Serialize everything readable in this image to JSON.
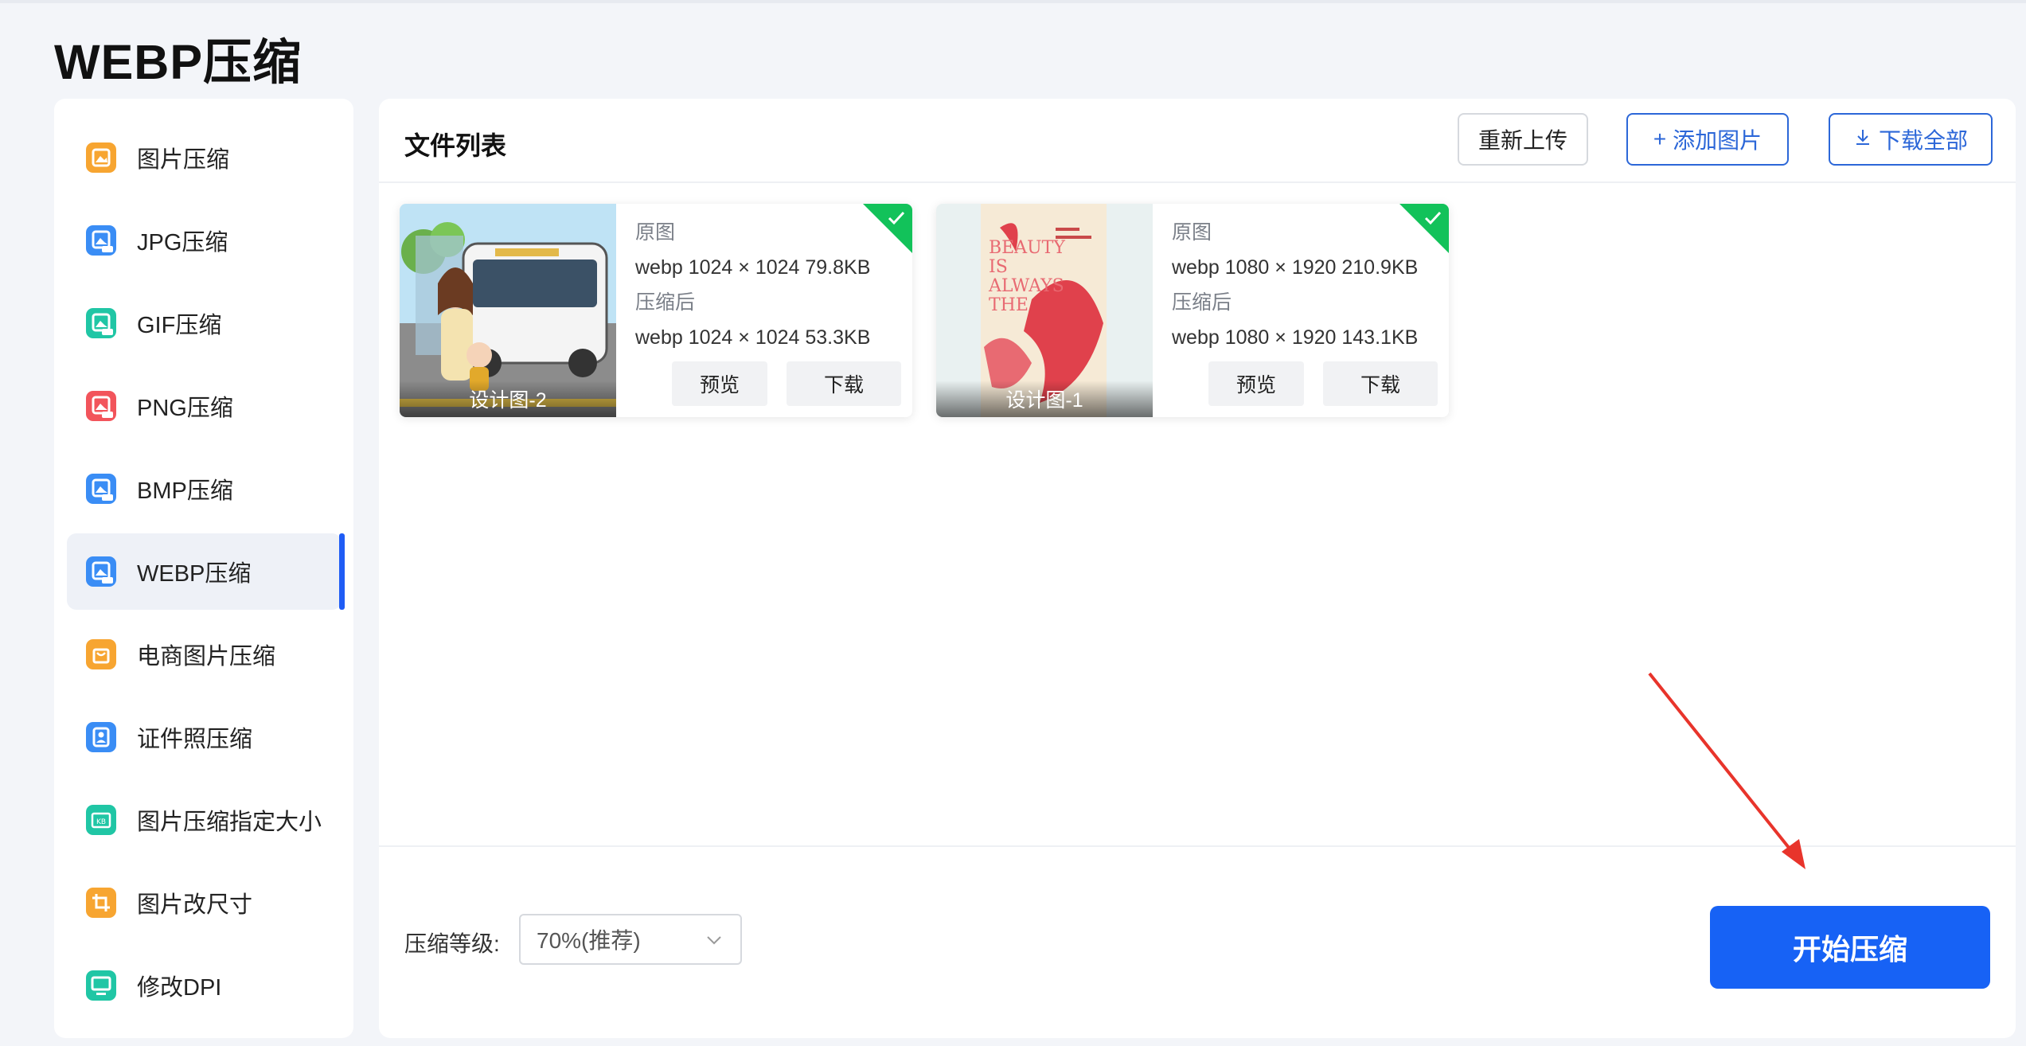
{
  "page": {
    "title": "WEBP压缩"
  },
  "sidebar": {
    "active_index": 5,
    "items": [
      {
        "label": "图片压缩",
        "icon": "image-compress-icon",
        "color": "#f7a531"
      },
      {
        "label": "JPG压缩",
        "icon": "jpg-icon",
        "color": "#3a8df5"
      },
      {
        "label": "GIF压缩",
        "icon": "gif-icon",
        "color": "#20c6a5"
      },
      {
        "label": "PNG压缩",
        "icon": "png-icon",
        "color": "#f2545b"
      },
      {
        "label": "BMP压缩",
        "icon": "bmp-icon",
        "color": "#3a8df5"
      },
      {
        "label": "WEBP压缩",
        "icon": "webp-icon",
        "color": "#3a8df5"
      },
      {
        "label": "电商图片压缩",
        "icon": "shopping-bag-icon",
        "color": "#f7a531"
      },
      {
        "label": "证件照压缩",
        "icon": "id-photo-icon",
        "color": "#3a8df5"
      },
      {
        "label": "图片压缩指定大小",
        "icon": "kb-folder-icon",
        "color": "#20c6a5"
      },
      {
        "label": "图片改尺寸",
        "icon": "crop-icon",
        "color": "#f7a531"
      },
      {
        "label": "修改DPI",
        "icon": "monitor-icon",
        "color": "#20c6a5"
      }
    ]
  },
  "file_list": {
    "title": "文件列表",
    "reupload": "重新上传",
    "add_image": "添加图片",
    "add_glyph": "+",
    "download_all": "下载全部"
  },
  "files": [
    {
      "name": "设计图-2",
      "original_label": "原图",
      "original": "webp  1024 × 1024  79.8KB",
      "compressed_label": "压缩后",
      "compressed": "webp  1024 × 1024  53.3KB",
      "preview": "预览",
      "download": "下载"
    },
    {
      "name": "设计图-1",
      "original_label": "原图",
      "original": "webp  1080 × 1920  210.9KB",
      "compressed_label": "压缩后",
      "compressed": "webp  1080 × 1920  143.1KB",
      "preview": "预览",
      "download": "下载",
      "poster_text": [
        "BEAUTY",
        "IS",
        "ALWAYS",
        "THE"
      ]
    }
  ],
  "footer": {
    "level_label": "压缩等级:",
    "level_value": "70%(推荐)",
    "start": "开始压缩"
  },
  "colors": {
    "accent": "#1762f5",
    "success": "#12c25a",
    "arrow": "#e8342b"
  }
}
